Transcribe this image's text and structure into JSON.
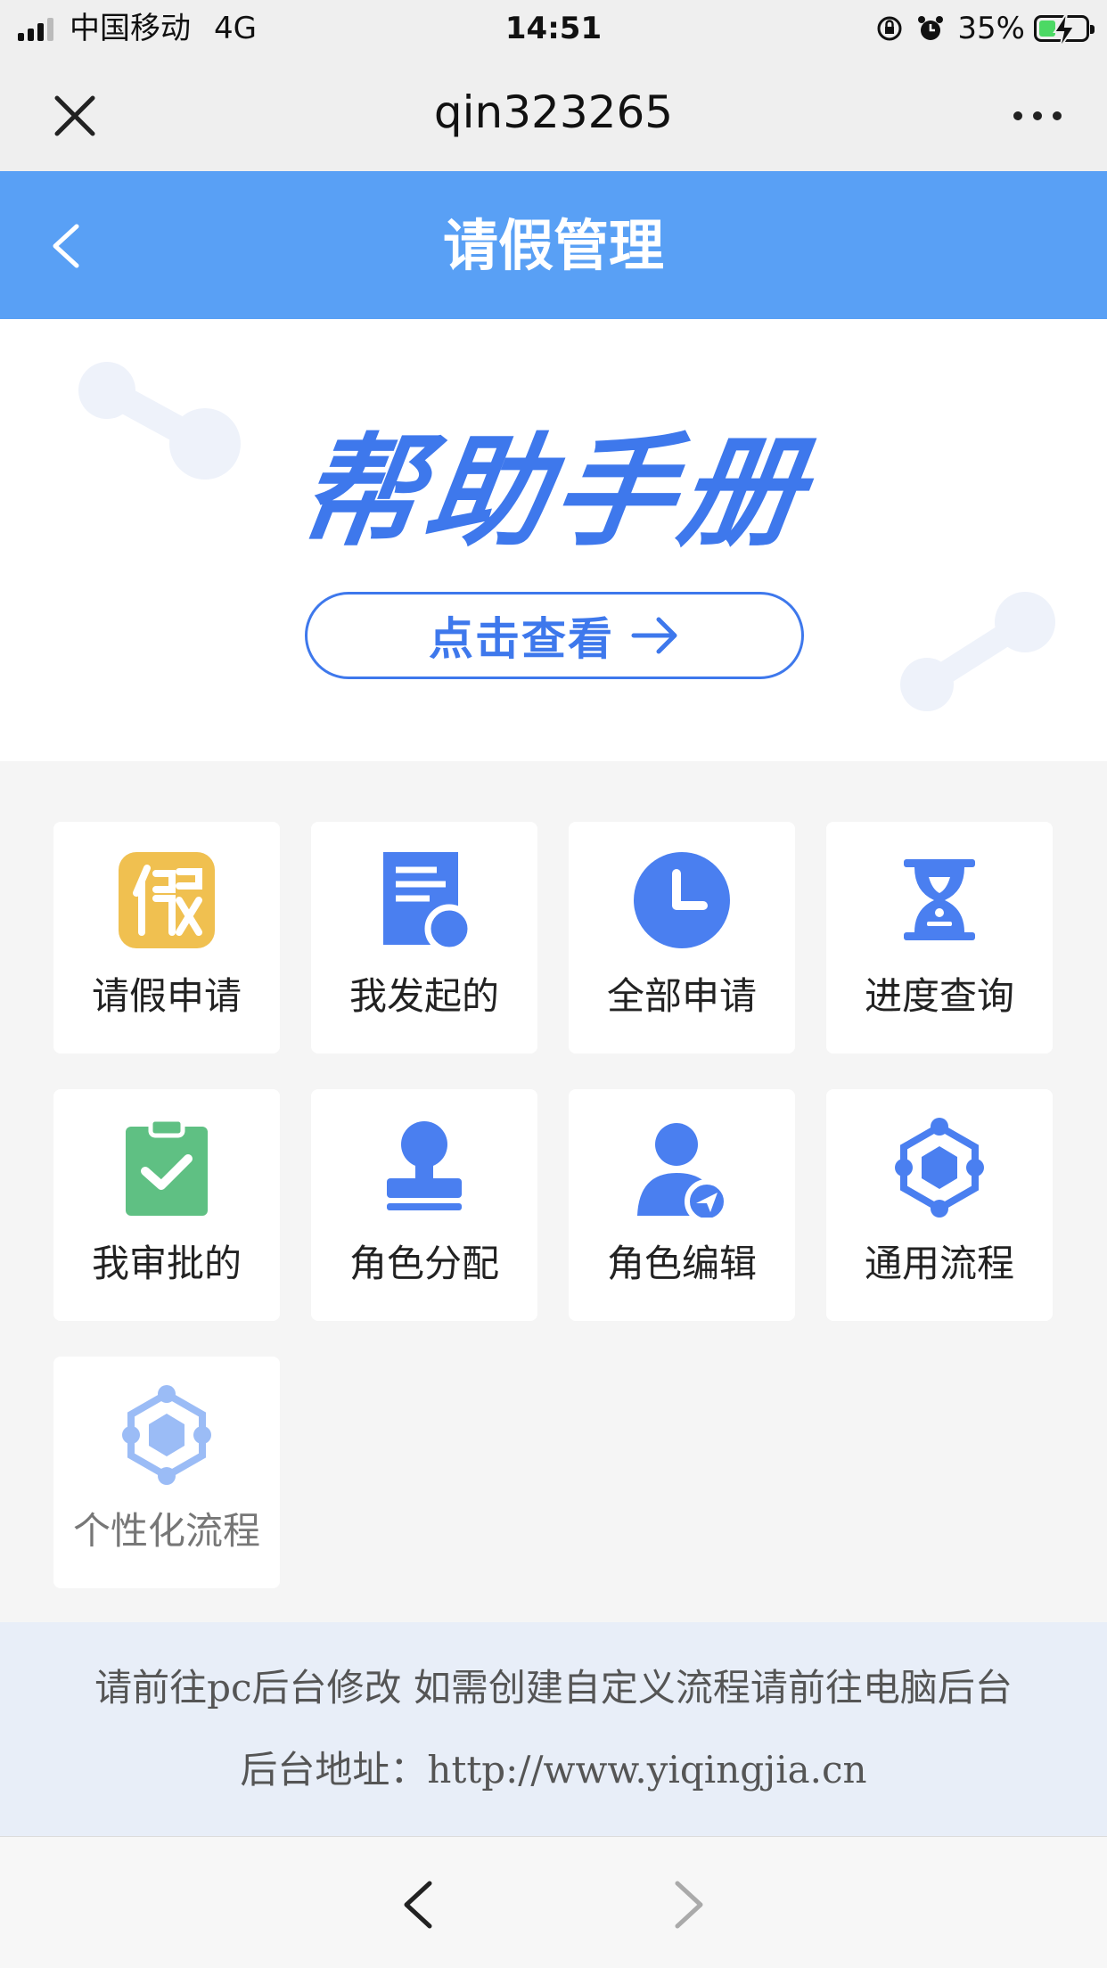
{
  "status_bar": {
    "carrier": "中国移动",
    "network": "4G",
    "time": "14:51",
    "battery": "35%",
    "battery_level": 0.35
  },
  "browser": {
    "title": "qin323265"
  },
  "header": {
    "title": "请假管理"
  },
  "banner": {
    "title": "帮助手册",
    "button_label": "点击查看"
  },
  "grid": {
    "items": [
      {
        "label": "请假申请",
        "icon": "leave-application-icon"
      },
      {
        "label": "我发起的",
        "icon": "document-icon"
      },
      {
        "label": "全部申请",
        "icon": "clock-icon"
      },
      {
        "label": "进度查询",
        "icon": "hourglass-icon"
      },
      {
        "label": "我审批的",
        "icon": "clipboard-check-icon"
      },
      {
        "label": "角色分配",
        "icon": "stamp-icon"
      },
      {
        "label": "角色编辑",
        "icon": "user-edit-icon"
      },
      {
        "label": "通用流程",
        "icon": "hexagon-network-icon"
      },
      {
        "label": "个性化流程",
        "icon": "hexagon-network-light-icon"
      }
    ]
  },
  "notice": {
    "line1": "请前往pc后台修改 如需创建自定义流程请前往电脑后台",
    "line2": "后台地址：http://www.yiqingjia.cn"
  },
  "colors": {
    "header": "#59a0f5",
    "accent": "#3e78ec",
    "leave_icon": "#f0c050",
    "approve_icon": "#5fc083"
  }
}
